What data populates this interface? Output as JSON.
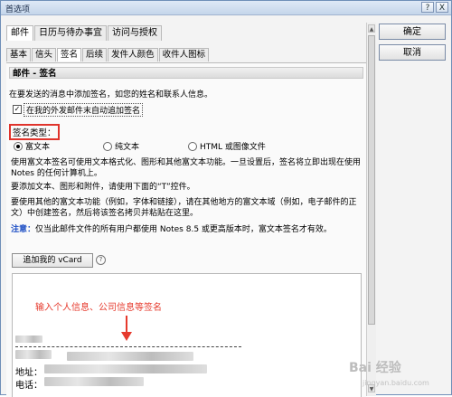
{
  "window": {
    "title": "首选项",
    "help": "?",
    "close": "X"
  },
  "tabs_primary": [
    "邮件",
    "日历与待办事宜",
    "访问与授权"
  ],
  "tabs_secondary": [
    "基本",
    "信头",
    "签名",
    "后续",
    "发件人颜色",
    "收件人图标"
  ],
  "section_title": "邮件 - 签名",
  "intro": "在要发送的消息中添加签名，如您的姓名和联系人信息。",
  "auto_append_label": "在我的外发邮件末自动追加签名",
  "auto_append_checked": "✓",
  "sig_type_label": "签名类型：",
  "radio_options": [
    "富文本",
    "纯文本",
    "HTML 或图像文件"
  ],
  "para1": "使用富文本签名可使用文本格式化、图形和其他富文本功能。一旦设置后，签名将立即出现在使用 Notes 的任何计算机上。",
  "para2": "要添加文本、图形和附件，请使用下面的“T”控件。",
  "para3": "要使用其他的富文本功能（例如，字体和链接），请在其他地方的富文本域（例如，电子邮件的正文）中创建签名，然后将该签名拷贝并粘贴在这里。",
  "note_label": "注意：",
  "note_text": "仅当此邮件文件的所有用户都使用 Notes 8.5 或更高版本时，富文本签名才有效。",
  "vcard_button": "追加我的 vCard",
  "help_icon_text": "?",
  "annotation": "输入个人信息、公司信息等签名",
  "addr_label": "地址：",
  "phone_label": "电话：",
  "buttons": {
    "ok": "确定",
    "cancel": "取消"
  },
  "watermark": "Bai 经验",
  "watermark_sub": "jingyan.baidu.com",
  "colors": {
    "annotation": "#e63a2d",
    "highlight_box": "#e0342c",
    "note": "#1e4fc4"
  }
}
